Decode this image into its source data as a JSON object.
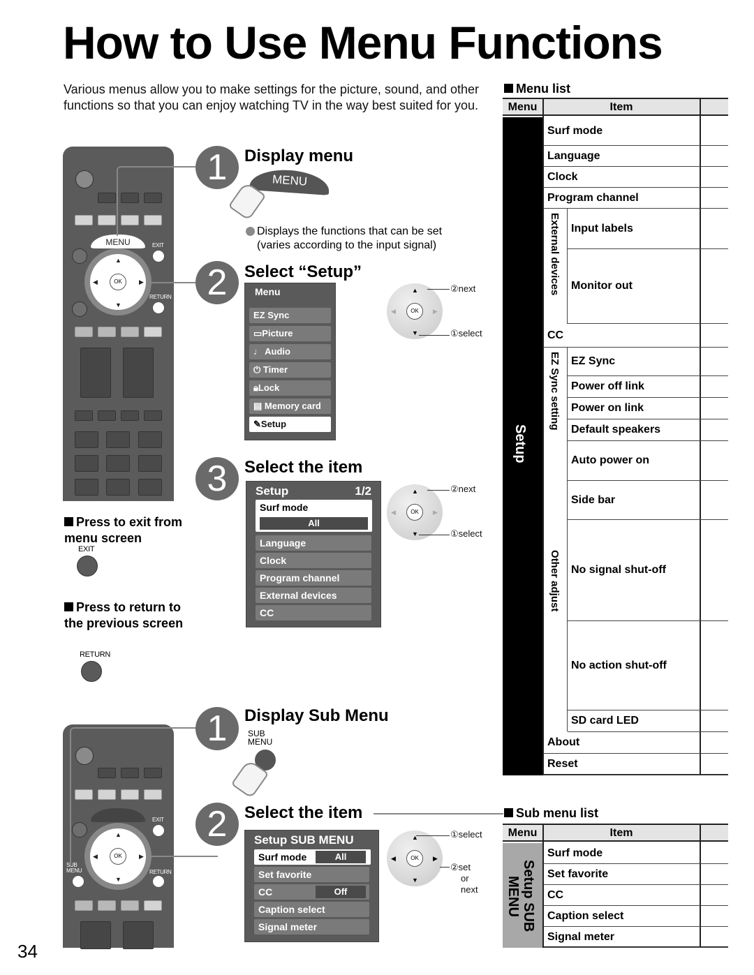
{
  "title": "How to Use Menu Functions",
  "intro": "Various menus allow you to make settings for the picture, sound, and other functions so that you can enjoy watching TV in the way best suited for you.",
  "page_number": "34",
  "remote_labels": {
    "menu": "MENU",
    "exit": "EXIT",
    "return": "RETURN",
    "ok": "OK",
    "sub_menu": "SUB MENU"
  },
  "main_steps": [
    {
      "number": "1",
      "title": "Display menu",
      "button_label": "MENU",
      "note": "Displays the functions that can be set (varies according to the input signal)"
    },
    {
      "number": "2",
      "title": "Select “Setup”"
    },
    {
      "number": "3",
      "title": "Select the item"
    }
  ],
  "menu_osd": {
    "title": "Menu",
    "items": [
      "EZ Sync",
      "Picture",
      "Audio",
      "Timer",
      "Lock",
      "Memory card",
      "Setup"
    ],
    "icons": [
      "",
      "picture-icon",
      "music-note-icon",
      "power-icon",
      "lock-icon",
      "memory-card-icon",
      "setup-icon"
    ],
    "selected": "Setup"
  },
  "dial_step2": {
    "next": "②next",
    "select": "①select"
  },
  "setup_osd": {
    "title": "Setup",
    "page": "1/2",
    "selected_item": "Surf mode",
    "selected_value": "All",
    "items": [
      "Language",
      "Clock",
      "Program channel",
      "External devices",
      "CC"
    ]
  },
  "dial_step3": {
    "next": "②next",
    "select": "①select"
  },
  "notes": {
    "exit_head": "Press to exit from menu screen",
    "exit_button": "EXIT",
    "return_head": "Press to return to the previous screen",
    "return_button": "RETURN"
  },
  "sub_steps": [
    {
      "number": "1",
      "title": "Display Sub Menu",
      "button_label": "SUB MENU"
    },
    {
      "number": "2",
      "title": "Select the item"
    }
  ],
  "sub_osd": {
    "title": "Setup SUB MENU",
    "items": [
      {
        "label": "Surf mode",
        "value": "All",
        "selected": true
      },
      {
        "label": "Set favorite",
        "value": ""
      },
      {
        "label": "CC",
        "value": "Off"
      },
      {
        "label": "Caption select",
        "value": ""
      },
      {
        "label": "Signal meter",
        "value": ""
      }
    ]
  },
  "dial_sub": {
    "select": "①select",
    "set": "②set",
    "or": "or",
    "next": "next"
  },
  "menu_list": {
    "heading": "Menu list",
    "col_menu": "Menu",
    "col_item": "Item",
    "menu_name": "Setup",
    "groups": {
      "external": "External devices",
      "ezsync": "EZ Sync setting",
      "other": "Other adjust"
    },
    "rows": [
      "Surf mode",
      "Language",
      "Clock",
      "Program channel",
      "Input labels",
      "Monitor out",
      "CC",
      "EZ Sync",
      "Power off link",
      "Power on link",
      "Default speakers",
      "Auto power on",
      "Side bar",
      "No signal shut-off",
      "No action shut-off",
      "SD card LED",
      "About",
      "Reset"
    ]
  },
  "sub_menu_list": {
    "heading": "Sub menu list",
    "col_menu": "Menu",
    "col_item": "Item",
    "menu_name": "Setup SUB MENU",
    "rows": [
      "Surf mode",
      "Set favorite",
      "CC",
      "Caption select",
      "Signal meter"
    ]
  }
}
